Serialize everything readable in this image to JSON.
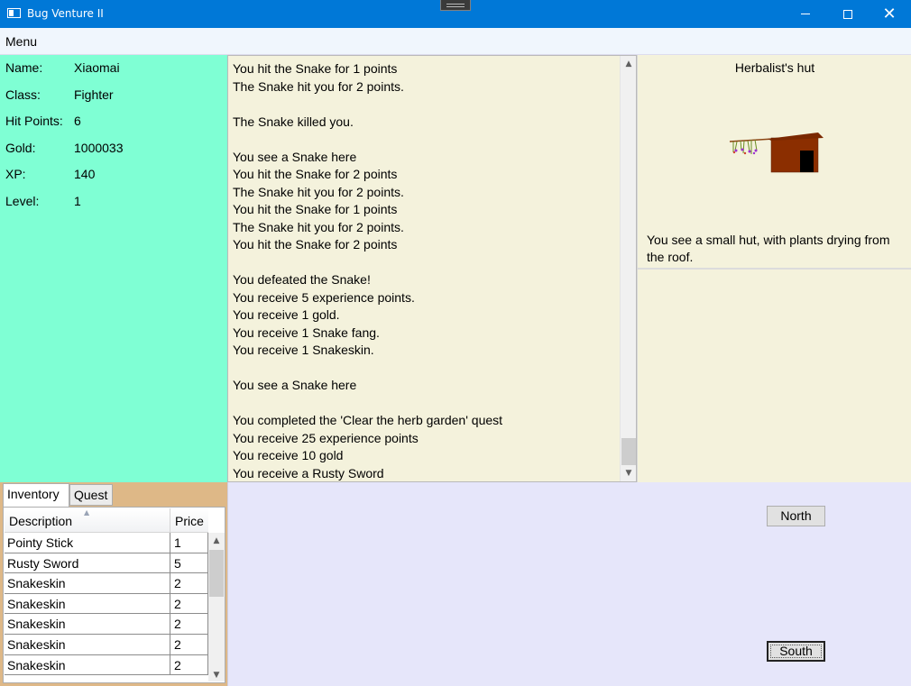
{
  "window": {
    "title": "Bug Venture II",
    "icon": "app-window-icon",
    "controls": {
      "minimize": "minimize-icon",
      "maximize": "maximize-icon",
      "close": "✕"
    }
  },
  "menu": {
    "items": [
      "Menu"
    ]
  },
  "player": {
    "name_label": "Name:",
    "name": "Xiaomai",
    "class_label": "Class:",
    "class": "Fighter",
    "hp_label": "Hit Points:",
    "hp": "6",
    "gold_label": "Gold:",
    "gold": "1000033",
    "xp_label": "XP:",
    "xp": "140",
    "level_label": "Level:",
    "level": "1"
  },
  "messages": {
    "text": "You hit the Snake for 1 points\nThe Snake hit you for 2 points.\n\nThe Snake killed you.\n\nYou see a Snake here\nYou hit the Snake for 2 points\nThe Snake hit you for 2 points.\nYou hit the Snake for 1 points\nThe Snake hit you for 2 points.\nYou hit the Snake for 2 points\n\nYou defeated the Snake!\nYou receive 5 experience points.\nYou receive 1 gold.\nYou receive 1 Snake fang.\nYou receive 1 Snakeskin.\n\nYou see a Snake here\n\nYou completed the 'Clear the herb garden' quest\nYou receive 25 experience points\nYou receive 10 gold\nYou receive a Rusty Sword"
  },
  "location": {
    "name": "Herbalist's hut",
    "image": "herbalist-hut-image",
    "description": "You see a small hut, with plants drying from the roof."
  },
  "tabs": [
    {
      "label": "Inventory",
      "active": true
    },
    {
      "label": "Quest",
      "active": false
    }
  ],
  "inventory": {
    "columns": [
      "Description",
      "Price"
    ],
    "rows": [
      {
        "description": "Pointy Stick",
        "price": "1"
      },
      {
        "description": "Rusty Sword",
        "price": "5"
      },
      {
        "description": "Snakeskin",
        "price": "2"
      },
      {
        "description": "Snakeskin",
        "price": "2"
      },
      {
        "description": "Snakeskin",
        "price": "2"
      },
      {
        "description": "Snakeskin",
        "price": "2"
      },
      {
        "description": "Snakeskin",
        "price": "2"
      }
    ]
  },
  "controls": {
    "north": "North",
    "south": "South"
  },
  "colors": {
    "titlebar": "#0078d7",
    "stats_panel": "#7fffd4",
    "text_panels": "#f4f2dc",
    "tabs_area": "#deb887",
    "controls_area": "#e6e6fa"
  }
}
